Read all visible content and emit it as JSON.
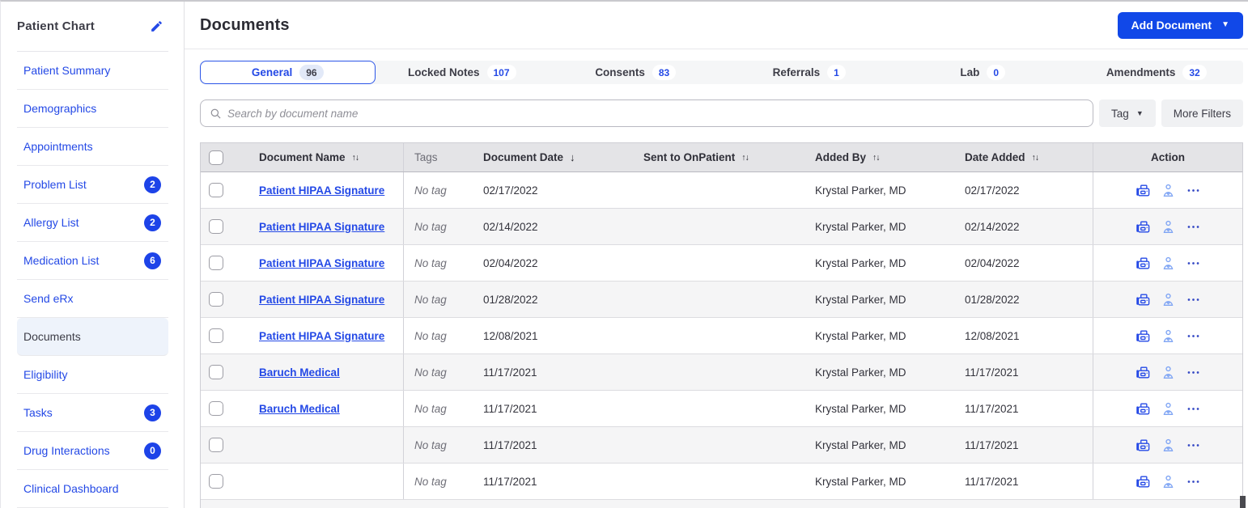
{
  "sidebar": {
    "title": "Patient Chart",
    "items": [
      {
        "label": "Patient Summary"
      },
      {
        "label": "Demographics"
      },
      {
        "label": "Appointments"
      },
      {
        "label": "Problem List",
        "badge": "2"
      },
      {
        "label": "Allergy List",
        "badge": "2"
      },
      {
        "label": "Medication List",
        "badge": "6"
      },
      {
        "label": "Send eRx"
      },
      {
        "label": "Documents",
        "selected": true
      },
      {
        "label": "Eligibility"
      },
      {
        "label": "Tasks",
        "badge": "3"
      },
      {
        "label": "Drug Interactions",
        "badge": "0"
      },
      {
        "label": "Clinical Dashboard"
      }
    ]
  },
  "header": {
    "title": "Documents",
    "add_button_label": "Add Document"
  },
  "tabs": [
    {
      "label": "General",
      "count": "96",
      "selected": true
    },
    {
      "label": "Locked Notes",
      "count": "107"
    },
    {
      "label": "Consents",
      "count": "83"
    },
    {
      "label": "Referrals",
      "count": "1"
    },
    {
      "label": "Lab",
      "count": "0"
    },
    {
      "label": "Amendments",
      "count": "32"
    }
  ],
  "filters": {
    "search_placeholder": "Search by document name",
    "tag_button": "Tag",
    "more_filters_button": "More Filters"
  },
  "table": {
    "columns": [
      {
        "label": "Document Name",
        "sort": "both"
      },
      {
        "label": "Tags",
        "sort": "none"
      },
      {
        "label": "Document Date",
        "sort": "down"
      },
      {
        "label": "Sent to OnPatient",
        "sort": "both"
      },
      {
        "label": "Added By",
        "sort": "both"
      },
      {
        "label": "Date Added",
        "sort": "both"
      },
      {
        "label": "Action",
        "sort": "none"
      }
    ],
    "action_icons": [
      "fax-icon",
      "onpatient-icon",
      "more-actions-icon"
    ],
    "rows": [
      {
        "name": "Patient HIPAA Signature",
        "tag": "No tag",
        "doc_date": "02/17/2022",
        "sent": "",
        "added_by": "Krystal Parker, MD",
        "date_added": "02/17/2022"
      },
      {
        "name": "Patient HIPAA Signature",
        "tag": "No tag",
        "doc_date": "02/14/2022",
        "sent": "",
        "added_by": "Krystal Parker, MD",
        "date_added": "02/14/2022"
      },
      {
        "name": "Patient HIPAA Signature",
        "tag": "No tag",
        "doc_date": "02/04/2022",
        "sent": "",
        "added_by": "Krystal Parker, MD",
        "date_added": "02/04/2022"
      },
      {
        "name": "Patient HIPAA Signature",
        "tag": "No tag",
        "doc_date": "01/28/2022",
        "sent": "",
        "added_by": "Krystal Parker, MD",
        "date_added": "01/28/2022"
      },
      {
        "name": "Patient HIPAA Signature",
        "tag": "No tag",
        "doc_date": "12/08/2021",
        "sent": "",
        "added_by": "Krystal Parker, MD",
        "date_added": "12/08/2021"
      },
      {
        "name": "Baruch Medical",
        "tag": "No tag",
        "doc_date": "11/17/2021",
        "sent": "",
        "added_by": "Krystal Parker, MD",
        "date_added": "11/17/2021"
      },
      {
        "name": "Baruch Medical",
        "tag": "No tag",
        "doc_date": "11/17/2021",
        "sent": "",
        "added_by": "Krystal Parker, MD",
        "date_added": "11/17/2021"
      },
      {
        "name": "",
        "tag": "No tag",
        "doc_date": "11/17/2021",
        "sent": "",
        "added_by": "Krystal Parker, MD",
        "date_added": "11/17/2021"
      },
      {
        "name": "",
        "tag": "No tag",
        "doc_date": "11/17/2021",
        "sent": "",
        "added_by": "Krystal Parker, MD",
        "date_added": "11/17/2021"
      }
    ]
  },
  "colors": {
    "primary_blue": "#1148e8",
    "link_blue": "#2449e6",
    "badge_blue": "#1d43e8",
    "selected_nav_bg": "#eef3fb",
    "tab_bar_bg": "#f5f6f7",
    "table_header_bg": "#e4e4e7",
    "alt_row_bg": "#f5f5f6",
    "text_dark": "#33333c",
    "muted_text": "#6f6f78",
    "onpatient_icon_blue": "#7ea4f4"
  }
}
